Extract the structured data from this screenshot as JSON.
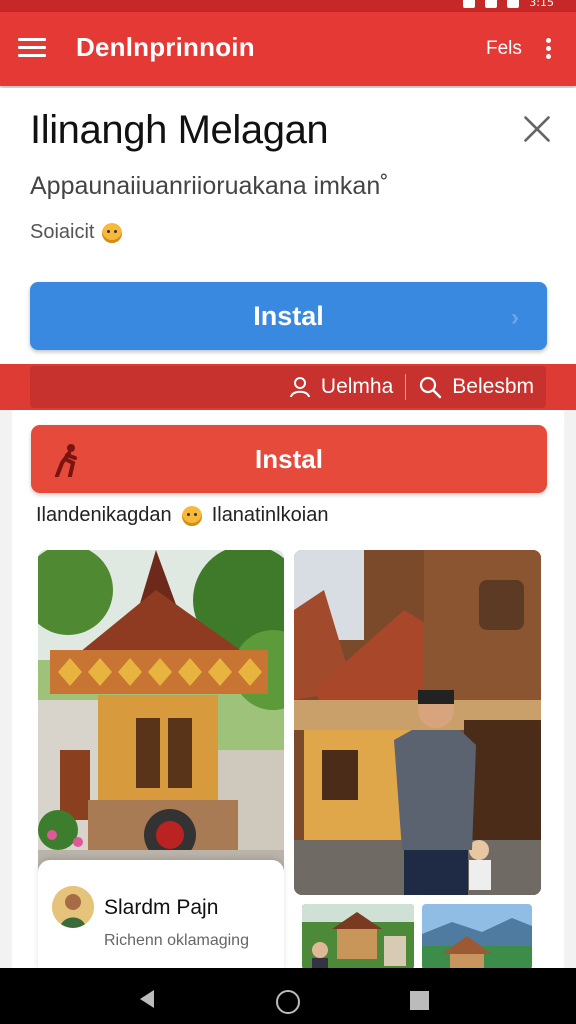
{
  "status_bar": {
    "time": "3:15"
  },
  "app_bar": {
    "title": "Denlnprinnoin",
    "link_label": "Fels"
  },
  "sheet": {
    "title": "Ilinangh Melagan",
    "subtitle": "Appaunaiiuanriioruakana imkan˚",
    "meta": "Soiaicit"
  },
  "buttons": {
    "install_primary": "Instal",
    "install_secondary": "Instal"
  },
  "toolbar": {
    "user_label": "Uelmha",
    "search_label": "Belesbm"
  },
  "tagline": {
    "left": "Ilandenikagdan",
    "right": "Ilanatinlkoian"
  },
  "profile": {
    "name": "Slardm Pajn",
    "description": "Richenn oklamaging"
  },
  "colors": {
    "app_bar": "#e53935",
    "install_primary": "#3a89e0",
    "install_secondary": "#e64a3a",
    "toolbar": "#dd3b33"
  },
  "icons": [
    "menu-icon",
    "more-icon",
    "close-icon",
    "user-icon",
    "search-icon",
    "runner-icon",
    "smile-icon",
    "back-icon",
    "home-icon",
    "recents-icon"
  ]
}
